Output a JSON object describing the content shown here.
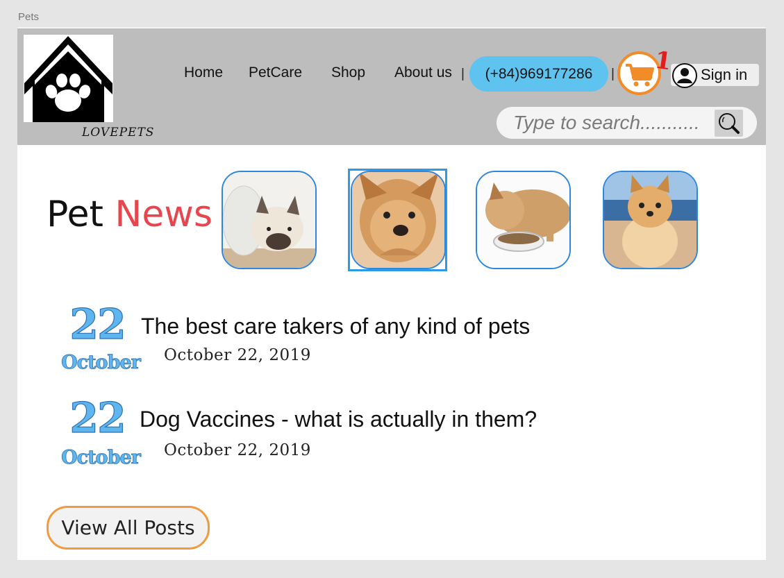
{
  "window": {
    "title": "Pets"
  },
  "header": {
    "logo_text": "LOVEPETS",
    "nav": [
      "Home",
      "PetCare",
      "Shop",
      "About us"
    ],
    "separator": "|",
    "phone": "(+84)969177286",
    "cart_count": "1",
    "signin_label": "Sign in",
    "search_placeholder": "Type to search.............",
    "colors": {
      "header_bg": "#bdbdbd",
      "phone_bg": "#5ec3ee",
      "cart": "#f28c28",
      "badge": "#e31c1c"
    }
  },
  "news": {
    "heading_word1": "Pet",
    "heading_word2": "News",
    "thumbnails": [
      "french-bulldog-cone",
      "yorkie-face",
      "dog-eating-bowl",
      "pomeranian-beach"
    ],
    "selected_thumbnail": 1,
    "posts": [
      {
        "day": "22",
        "month": "October",
        "title": "The best care takers of any kind of pets",
        "date": "October 22, 2019"
      },
      {
        "day": "22",
        "month": "October",
        "title": "Dog Vaccines - what is actually in them?",
        "date": "October 22, 2019"
      }
    ],
    "view_all_label": "View All Posts"
  },
  "icons": {
    "cart": "cart-icon",
    "user": "user-icon",
    "search": "search-icon",
    "logo": "paw-house-logo"
  }
}
